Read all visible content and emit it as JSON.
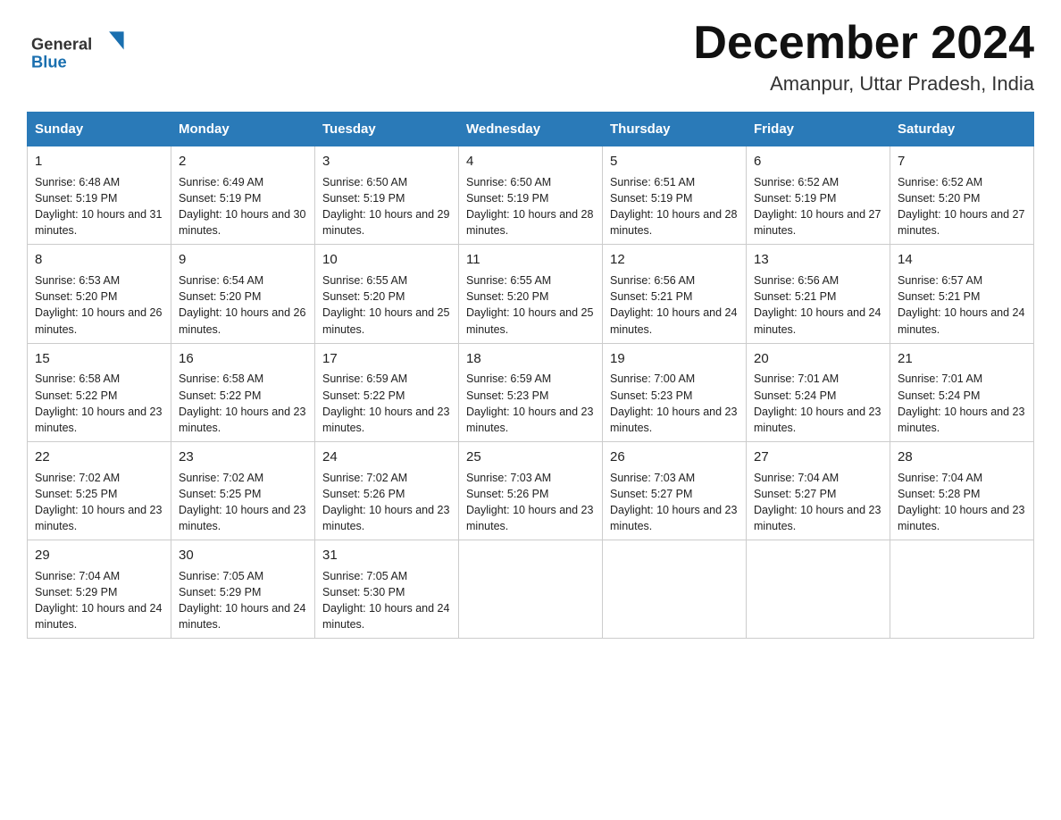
{
  "header": {
    "logo_general": "General",
    "logo_blue": "Blue",
    "month_title": "December 2024",
    "location": "Amanpur, Uttar Pradesh, India"
  },
  "days_of_week": [
    "Sunday",
    "Monday",
    "Tuesday",
    "Wednesday",
    "Thursday",
    "Friday",
    "Saturday"
  ],
  "weeks": [
    [
      {
        "day": "1",
        "sunrise": "6:48 AM",
        "sunset": "5:19 PM",
        "daylight": "10 hours and 31 minutes."
      },
      {
        "day": "2",
        "sunrise": "6:49 AM",
        "sunset": "5:19 PM",
        "daylight": "10 hours and 30 minutes."
      },
      {
        "day": "3",
        "sunrise": "6:50 AM",
        "sunset": "5:19 PM",
        "daylight": "10 hours and 29 minutes."
      },
      {
        "day": "4",
        "sunrise": "6:50 AM",
        "sunset": "5:19 PM",
        "daylight": "10 hours and 28 minutes."
      },
      {
        "day": "5",
        "sunrise": "6:51 AM",
        "sunset": "5:19 PM",
        "daylight": "10 hours and 28 minutes."
      },
      {
        "day": "6",
        "sunrise": "6:52 AM",
        "sunset": "5:19 PM",
        "daylight": "10 hours and 27 minutes."
      },
      {
        "day": "7",
        "sunrise": "6:52 AM",
        "sunset": "5:20 PM",
        "daylight": "10 hours and 27 minutes."
      }
    ],
    [
      {
        "day": "8",
        "sunrise": "6:53 AM",
        "sunset": "5:20 PM",
        "daylight": "10 hours and 26 minutes."
      },
      {
        "day": "9",
        "sunrise": "6:54 AM",
        "sunset": "5:20 PM",
        "daylight": "10 hours and 26 minutes."
      },
      {
        "day": "10",
        "sunrise": "6:55 AM",
        "sunset": "5:20 PM",
        "daylight": "10 hours and 25 minutes."
      },
      {
        "day": "11",
        "sunrise": "6:55 AM",
        "sunset": "5:20 PM",
        "daylight": "10 hours and 25 minutes."
      },
      {
        "day": "12",
        "sunrise": "6:56 AM",
        "sunset": "5:21 PM",
        "daylight": "10 hours and 24 minutes."
      },
      {
        "day": "13",
        "sunrise": "6:56 AM",
        "sunset": "5:21 PM",
        "daylight": "10 hours and 24 minutes."
      },
      {
        "day": "14",
        "sunrise": "6:57 AM",
        "sunset": "5:21 PM",
        "daylight": "10 hours and 24 minutes."
      }
    ],
    [
      {
        "day": "15",
        "sunrise": "6:58 AM",
        "sunset": "5:22 PM",
        "daylight": "10 hours and 23 minutes."
      },
      {
        "day": "16",
        "sunrise": "6:58 AM",
        "sunset": "5:22 PM",
        "daylight": "10 hours and 23 minutes."
      },
      {
        "day": "17",
        "sunrise": "6:59 AM",
        "sunset": "5:22 PM",
        "daylight": "10 hours and 23 minutes."
      },
      {
        "day": "18",
        "sunrise": "6:59 AM",
        "sunset": "5:23 PM",
        "daylight": "10 hours and 23 minutes."
      },
      {
        "day": "19",
        "sunrise": "7:00 AM",
        "sunset": "5:23 PM",
        "daylight": "10 hours and 23 minutes."
      },
      {
        "day": "20",
        "sunrise": "7:01 AM",
        "sunset": "5:24 PM",
        "daylight": "10 hours and 23 minutes."
      },
      {
        "day": "21",
        "sunrise": "7:01 AM",
        "sunset": "5:24 PM",
        "daylight": "10 hours and 23 minutes."
      }
    ],
    [
      {
        "day": "22",
        "sunrise": "7:02 AM",
        "sunset": "5:25 PM",
        "daylight": "10 hours and 23 minutes."
      },
      {
        "day": "23",
        "sunrise": "7:02 AM",
        "sunset": "5:25 PM",
        "daylight": "10 hours and 23 minutes."
      },
      {
        "day": "24",
        "sunrise": "7:02 AM",
        "sunset": "5:26 PM",
        "daylight": "10 hours and 23 minutes."
      },
      {
        "day": "25",
        "sunrise": "7:03 AM",
        "sunset": "5:26 PM",
        "daylight": "10 hours and 23 minutes."
      },
      {
        "day": "26",
        "sunrise": "7:03 AM",
        "sunset": "5:27 PM",
        "daylight": "10 hours and 23 minutes."
      },
      {
        "day": "27",
        "sunrise": "7:04 AM",
        "sunset": "5:27 PM",
        "daylight": "10 hours and 23 minutes."
      },
      {
        "day": "28",
        "sunrise": "7:04 AM",
        "sunset": "5:28 PM",
        "daylight": "10 hours and 23 minutes."
      }
    ],
    [
      {
        "day": "29",
        "sunrise": "7:04 AM",
        "sunset": "5:29 PM",
        "daylight": "10 hours and 24 minutes."
      },
      {
        "day": "30",
        "sunrise": "7:05 AM",
        "sunset": "5:29 PM",
        "daylight": "10 hours and 24 minutes."
      },
      {
        "day": "31",
        "sunrise": "7:05 AM",
        "sunset": "5:30 PM",
        "daylight": "10 hours and 24 minutes."
      },
      null,
      null,
      null,
      null
    ]
  ]
}
